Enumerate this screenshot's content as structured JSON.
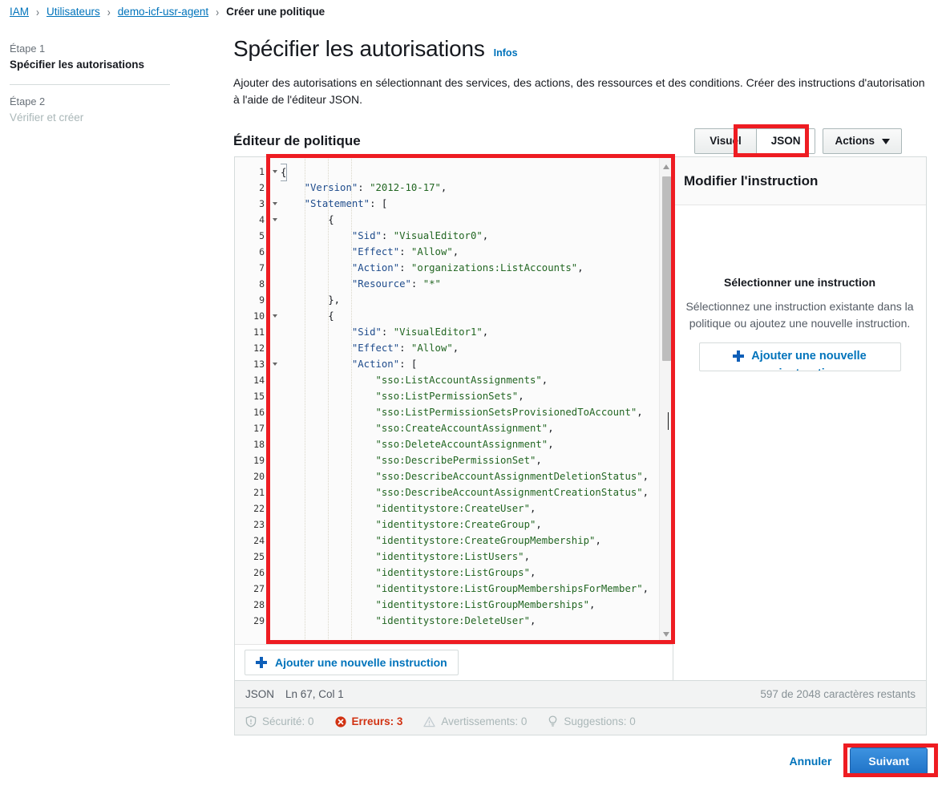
{
  "breadcrumb": {
    "items": [
      {
        "label": "IAM",
        "link": true
      },
      {
        "label": "Utilisateurs",
        "link": true
      },
      {
        "label": "demo-icf-usr-agent",
        "link": true
      },
      {
        "label": "Créer une politique",
        "link": false
      }
    ],
    "separator": "›"
  },
  "stepper": {
    "step1_num": "Étape 1",
    "step1_title": "Spécifier les autorisations",
    "step2_num": "Étape 2",
    "step2_title": "Vérifier et créer"
  },
  "header": {
    "title": "Spécifier les autorisations",
    "infos_label": "Infos",
    "description": "Ajouter des autorisations en sélectionnant des services, des actions, des ressources et des conditions. Créer des instructions d'autorisation à l'aide de l'éditeur JSON."
  },
  "editor": {
    "section_title": "Éditeur de politique",
    "tabs": [
      {
        "label": "Visuel",
        "active": false
      },
      {
        "label": "JSON",
        "active": true
      }
    ],
    "actions_label": "Actions",
    "add_statement_label": "Ajouter une nouvelle instruction",
    "code_lines": [
      {
        "n": 1,
        "fold": true,
        "text": "{",
        "cursor": true
      },
      {
        "n": 2,
        "fold": false,
        "text": "    \"Version\": \"2012-10-17\","
      },
      {
        "n": 3,
        "fold": true,
        "text": "    \"Statement\": ["
      },
      {
        "n": 4,
        "fold": true,
        "text": "        {"
      },
      {
        "n": 5,
        "fold": false,
        "text": "            \"Sid\": \"VisualEditor0\","
      },
      {
        "n": 6,
        "fold": false,
        "text": "            \"Effect\": \"Allow\","
      },
      {
        "n": 7,
        "fold": false,
        "text": "            \"Action\": \"organizations:ListAccounts\","
      },
      {
        "n": 8,
        "fold": false,
        "text": "            \"Resource\": \"*\""
      },
      {
        "n": 9,
        "fold": false,
        "text": "        },"
      },
      {
        "n": 10,
        "fold": true,
        "text": "        {"
      },
      {
        "n": 11,
        "fold": false,
        "text": "            \"Sid\": \"VisualEditor1\","
      },
      {
        "n": 12,
        "fold": false,
        "text": "            \"Effect\": \"Allow\","
      },
      {
        "n": 13,
        "fold": true,
        "text": "            \"Action\": ["
      },
      {
        "n": 14,
        "fold": false,
        "text": "                \"sso:ListAccountAssignments\","
      },
      {
        "n": 15,
        "fold": false,
        "text": "                \"sso:ListPermissionSets\","
      },
      {
        "n": 16,
        "fold": false,
        "text": "                \"sso:ListPermissionSetsProvisionedToAccount\","
      },
      {
        "n": 17,
        "fold": false,
        "text": "                \"sso:CreateAccountAssignment\","
      },
      {
        "n": 18,
        "fold": false,
        "text": "                \"sso:DeleteAccountAssignment\","
      },
      {
        "n": 19,
        "fold": false,
        "text": "                \"sso:DescribePermissionSet\","
      },
      {
        "n": 20,
        "fold": false,
        "text": "                \"sso:DescribeAccountAssignmentDeletionStatus\","
      },
      {
        "n": 21,
        "fold": false,
        "text": "                \"sso:DescribeAccountAssignmentCreationStatus\","
      },
      {
        "n": 22,
        "fold": false,
        "text": "                \"identitystore:CreateUser\","
      },
      {
        "n": 23,
        "fold": false,
        "text": "                \"identitystore:CreateGroup\","
      },
      {
        "n": 24,
        "fold": false,
        "text": "                \"identitystore:CreateGroupMembership\","
      },
      {
        "n": 25,
        "fold": false,
        "text": "                \"identitystore:ListUsers\","
      },
      {
        "n": 26,
        "fold": false,
        "text": "                \"identitystore:ListGroups\","
      },
      {
        "n": 27,
        "fold": false,
        "text": "                \"identitystore:ListGroupMembershipsForMember\","
      },
      {
        "n": 28,
        "fold": false,
        "text": "                \"identitystore:ListGroupMemberships\","
      },
      {
        "n": 29,
        "fold": false,
        "text": "                \"identitystore:DeleteUser\","
      }
    ]
  },
  "right_panel": {
    "title": "Modifier l'instruction",
    "empty_title": "Sélectionner une instruction",
    "empty_desc": "Sélectionnez une instruction existante dans la politique ou ajoutez une nouvelle instruction.",
    "add_label_line1": "Ajouter une nouvelle",
    "add_label_line2": "instruction"
  },
  "status": {
    "format": "JSON",
    "position": "Ln 67, Col 1",
    "chars_remaining": "597 de 2048 caractères restants",
    "issues": [
      {
        "icon": "shield-icon",
        "label": "Sécurité: 0",
        "state": "muted"
      },
      {
        "icon": "error-circle-icon",
        "label": "Erreurs: 3",
        "state": "error"
      },
      {
        "icon": "warning-triangle-icon",
        "label": "Avertissements: 0",
        "state": "muted"
      },
      {
        "icon": "lightbulb-icon",
        "label": "Suggestions: 0",
        "state": "muted"
      }
    ]
  },
  "footer": {
    "cancel_label": "Annuler",
    "next_label": "Suivant"
  },
  "colors": {
    "link": "#0073bb",
    "error": "#d13212",
    "primary_button": "#1f72c7",
    "annotation_red": "#ee1c22",
    "muted": "#aab7b8"
  }
}
